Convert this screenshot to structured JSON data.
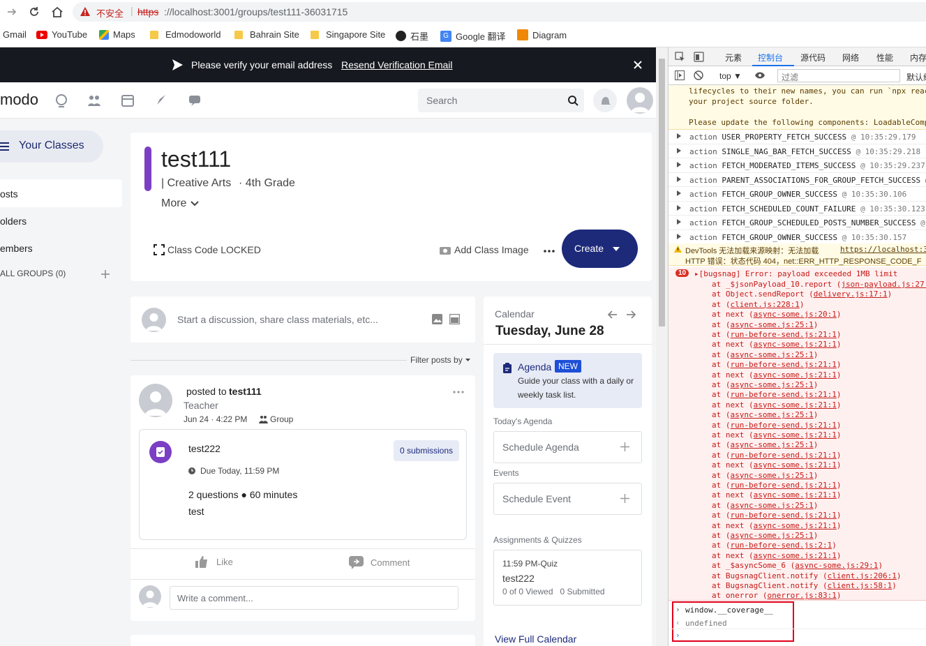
{
  "browser": {
    "security_label": "不安全",
    "url_scheme": "https",
    "url_rest": "://localhost:3001/groups/test111-36031715",
    "bookmarks": [
      {
        "label": "Gmail",
        "icon": "gmail-icon"
      },
      {
        "label": "YouTube",
        "icon": "youtube-icon"
      },
      {
        "label": "Maps",
        "icon": "maps-icon"
      },
      {
        "label": "Edmodoworld",
        "icon": "folder-icon"
      },
      {
        "label": "Bahrain Site",
        "icon": "folder-icon"
      },
      {
        "label": "Singapore Site",
        "icon": "folder-icon"
      },
      {
        "label": "石墨",
        "icon": "shimo-icon"
      },
      {
        "label": "Google 翻译",
        "icon": "google-translate-icon"
      },
      {
        "label": "Diagram",
        "icon": "diagram-icon"
      }
    ]
  },
  "banner": {
    "message": "Please verify your email address",
    "link": "Resend Verification Email"
  },
  "nav": {
    "logo": "modo",
    "search_placeholder": "Search"
  },
  "sidebar": {
    "your_classes": "Your Classes",
    "items": [
      {
        "label": "osts"
      },
      {
        "label": "olders"
      },
      {
        "label": "embers"
      }
    ],
    "groups_label": "ALL GROUPS (0)"
  },
  "class_header": {
    "title": "test111",
    "subject": "| Creative Arts",
    "grade": "· 4th Grade",
    "more": "More",
    "class_code": "Class Code LOCKED",
    "add_image": "Add Class Image",
    "create": "Create",
    "accent": "#7b3fc4"
  },
  "composer": {
    "placeholder": "Start a discussion, share class materials, etc..."
  },
  "filter": {
    "label": "Filter posts by"
  },
  "post": {
    "posted_to_prefix": "posted to",
    "posted_to": "test111",
    "role": "Teacher",
    "date": "Jun 24 · 4:22 PM",
    "audience": "Group",
    "quiz_title": "test222",
    "submissions": "0 submissions",
    "due": "Due Today, 11:59 PM",
    "meta": "2 questions ● 60 minutes",
    "description": "test",
    "like": "Like",
    "comment": "Comment",
    "comment_placeholder": "Write a comment..."
  },
  "calendar": {
    "label": "Calendar",
    "date": "Tuesday, June 28",
    "agenda_title": "Agenda",
    "agenda_badge": "NEW",
    "agenda_desc1": "Guide your class with a daily or",
    "agenda_desc2": "weekly task list.",
    "todays_agenda": "Today's Agenda",
    "schedule_agenda": "Schedule Agenda",
    "events": "Events",
    "schedule_event": "Schedule Event",
    "assignments": "Assignments & Quizzes",
    "quiz_time": "11:59 PM-Quiz",
    "quiz_name": "test222",
    "quiz_stats": "0 of 0 Viewed   0 Submitted",
    "view_full": "View Full Calendar"
  },
  "devtools": {
    "tabs": [
      "元素",
      "控制台",
      "源代码",
      "网络",
      "性能",
      "内存"
    ],
    "context": "top ▼",
    "filter_placeholder": "过滤",
    "default_levels": "默认级",
    "warn_lines": [
      "lifecycles to their new names, you can run `npx react",
      "your project source folder.",
      "",
      "Please update the following components: LoadableComp"
    ],
    "actions": [
      {
        "name": "USER_PROPERTY_FETCH_SUCCESS",
        "time": "@ 10:35:29.179"
      },
      {
        "name": "SINGLE_NAG_BAR_FETCH_SUCCESS",
        "time": "@ 10:35:29.218"
      },
      {
        "name": "FETCH_MODERATED_ITEMS_SUCCESS",
        "time": "@ 10:35:29.237"
      },
      {
        "name": "PARENT_ASSOCIATIONS_FOR_GROUP_FETCH_SUCCESS",
        "time": "@"
      },
      {
        "name": "FETCH_GROUP_OWNER_SUCCESS",
        "time": "@ 10:35:30.106"
      },
      {
        "name": "FETCH_SCHEDULED_COUNT_FAILURE",
        "time": "@ 10:35:30.123"
      },
      {
        "name": "FETCH_GROUP_SCHEDULED_POSTS_NUMBER_SUCCESS",
        "time": "@"
      },
      {
        "name": "FETCH_GROUP_OWNER_SUCCESS",
        "time": "@ 10:35:30.157"
      }
    ],
    "action_word": "action",
    "sourcemap_warning": "DevTools 无法加载来源映射：无法加载",
    "sourcemap_link": "https://localhost:3",
    "sourcemap_error": "HTTP 错误：状态代码 404，net::ERR_HTTP_RESPONSE_CODE_F",
    "error_count": "10",
    "error_message": "▸[bugsnag] Error: payload exceeded 1MB limit",
    "stack": [
      {
        "fn": "at _$jsonPayload_10.report",
        "src": "json-payload.js:27:"
      },
      {
        "fn": "at Object.sendReport",
        "src": "delivery.js:17:1"
      },
      {
        "fn": "at",
        "src": "client.js:228:1"
      },
      {
        "fn": "at next",
        "src": "async-some.js:20:1"
      },
      {
        "fn": "at",
        "src": "async-some.js:25:1"
      },
      {
        "fn": "at",
        "src": "run-before-send.js:21:1"
      },
      {
        "fn": "at next",
        "src": "async-some.js:21:1"
      },
      {
        "fn": "at",
        "src": "async-some.js:25:1"
      },
      {
        "fn": "at",
        "src": "run-before-send.js:21:1"
      },
      {
        "fn": "at next",
        "src": "async-some.js:21:1"
      },
      {
        "fn": "at",
        "src": "async-some.js:25:1"
      },
      {
        "fn": "at",
        "src": "run-before-send.js:21:1"
      },
      {
        "fn": "at next",
        "src": "async-some.js:21:1"
      },
      {
        "fn": "at",
        "src": "async-some.js:25:1"
      },
      {
        "fn": "at",
        "src": "run-before-send.js:21:1"
      },
      {
        "fn": "at next",
        "src": "async-some.js:21:1"
      },
      {
        "fn": "at",
        "src": "async-some.js:25:1"
      },
      {
        "fn": "at",
        "src": "run-before-send.js:21:1"
      },
      {
        "fn": "at next",
        "src": "async-some.js:21:1"
      },
      {
        "fn": "at",
        "src": "async-some.js:25:1"
      },
      {
        "fn": "at",
        "src": "run-before-send.js:21:1"
      },
      {
        "fn": "at next",
        "src": "async-some.js:21:1"
      },
      {
        "fn": "at",
        "src": "async-some.js:25:1"
      },
      {
        "fn": "at",
        "src": "run-before-send.js:21:1"
      },
      {
        "fn": "at next",
        "src": "async-some.js:21:1"
      },
      {
        "fn": "at",
        "src": "async-some.js:25:1"
      },
      {
        "fn": "at",
        "src": "run-before-send.js:2:1"
      },
      {
        "fn": "at next",
        "src": "async-some.js:21:1"
      },
      {
        "fn": "at _$asyncSome_6",
        "src": "async-some.js:29:1"
      },
      {
        "fn": "at BugsnagClient.notify",
        "src": "client.js:206:1"
      },
      {
        "fn": "at BugsnagClient.notify",
        "src": "client.js:58:1"
      },
      {
        "fn": "at onerror",
        "src": "onerror.js:83:1"
      }
    ],
    "console_input": "window.__coverage__",
    "console_result": "undefined"
  }
}
